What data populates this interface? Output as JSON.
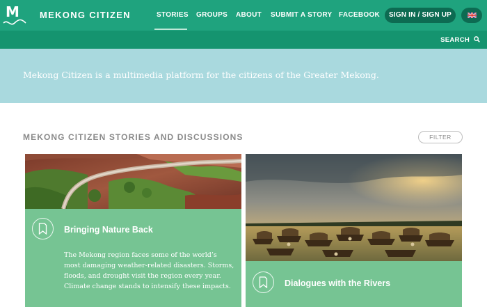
{
  "header": {
    "logo_letter": "M",
    "brand": "MEKONG CITIZEN",
    "nav": [
      {
        "label": "STORIES",
        "active": true
      },
      {
        "label": "GROUPS",
        "active": false
      },
      {
        "label": "ABOUT",
        "active": false
      },
      {
        "label": "SUBMIT A STORY",
        "active": false
      },
      {
        "label": "FACEBOOK",
        "active": false
      }
    ],
    "signin_label": "SIGN IN / SIGN UP",
    "language_icon": "uk-flag-icon"
  },
  "subbar": {
    "search_label": "SEARCH"
  },
  "banner": {
    "text": "Mekong Citizen is a multimedia platform for the citizens of the Greater Mekong."
  },
  "section": {
    "title": "MEKONG CITIZEN STORIES AND DISCUSSIONS",
    "filter_label": "FILTER"
  },
  "cards": [
    {
      "title": "Bringing Nature Back",
      "description": "The Mekong region faces some of the world’s most damaging weather-related disasters. Storms, floods, and drought visit the region every year. Climate change stands to intensify these impacts.",
      "image_icon": "mountain-road-photo"
    },
    {
      "title": "Dialogues with the Rivers",
      "description": "",
      "image_icon": "river-boats-photo"
    }
  ],
  "colors": {
    "nav_green": "#1fa37e",
    "subbar_green": "#15946f",
    "button_dark": "#0d6b52",
    "banner_blue": "#a9d9de",
    "card_green": "#76c493"
  }
}
